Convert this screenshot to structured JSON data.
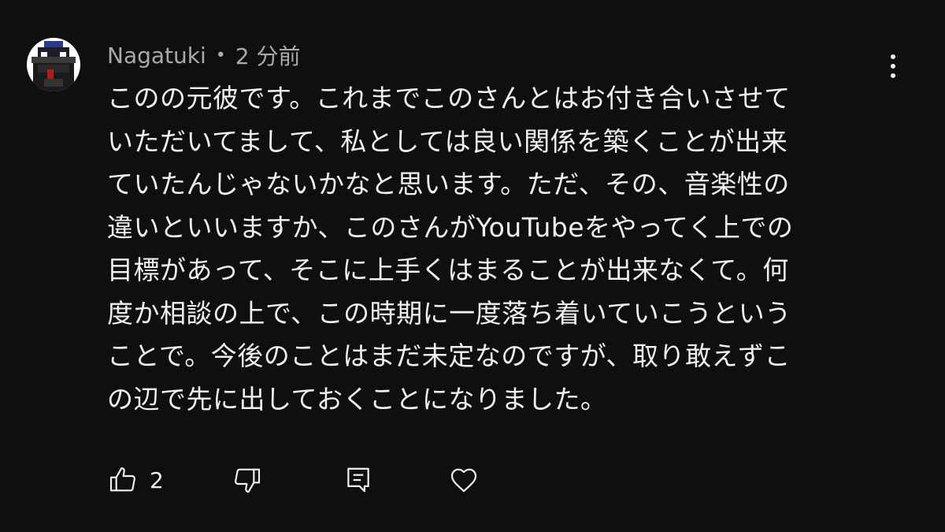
{
  "comment": {
    "author": "Nagatuki",
    "separator": "•",
    "time_ago": "2 分前",
    "text": "このの元彼です。これまでこのさんとはお付き合いさせて\nいただいてまして、私としては良い関係を築くことが出来\nていたんじゃないかなと思います。ただ、その、音楽性の\n違いといいますか、このさんがYouTubeをやってく上での\n目標があって、そこに上手くはまることが出来なくて。何\n度か相談の上で、この時期に一度落ち着いていこうという\nことで。今後のことはまだ未定なのですが、取り敢えずこ\nの辺で先に出しておくことになりました。",
    "like_count": "2"
  },
  "icons": {
    "menu": "more-vert-icon",
    "like": "thumb-up-icon",
    "dislike": "thumb-down-icon",
    "reply": "reply-comment-icon",
    "heart": "heart-icon"
  },
  "colors": {
    "background": "#0f0f0f",
    "text": "#f1f1f1",
    "meta": "#aaaaaa"
  }
}
